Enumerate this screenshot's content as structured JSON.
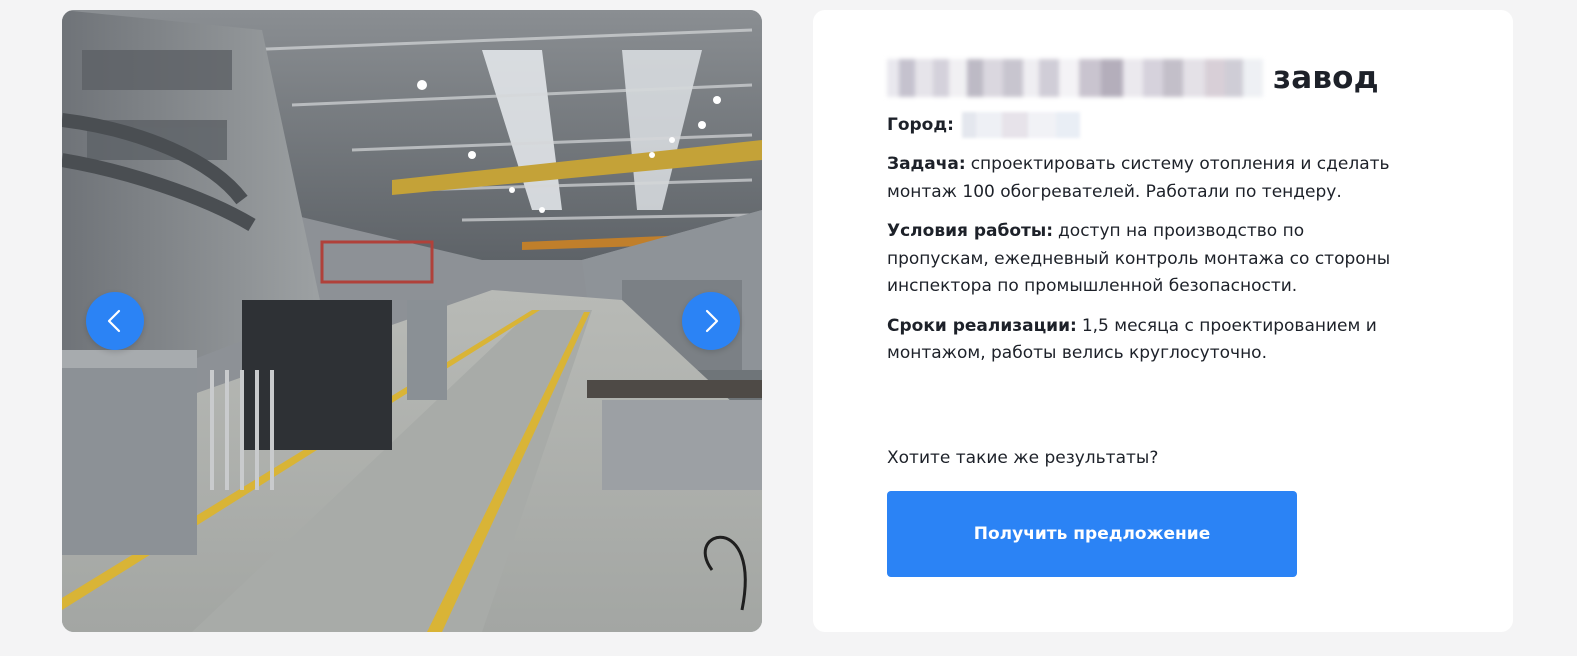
{
  "slider": {
    "prev_icon": "chevron-left-icon",
    "next_icon": "chevron-right-icon",
    "accent_color": "#2b83f5"
  },
  "card": {
    "title_suffix": "завод",
    "city_label": "Город:",
    "task_label": "Задача:",
    "task_text": "спроектировать систему отопления и сделать монтаж 100 обогревателей. Работали по тендеру.",
    "conditions_label": "Условия работы:",
    "conditions_text": "доступ на производство по пропускам, ежедневный контроль монтажа со стороны инспектора по промышленной безопасности.",
    "deadline_label": "Сроки реализации:",
    "deadline_text": "1,5 месяца с проектированием и монтажом, работы велись круглосуточно.",
    "cta_question": "Хотите такие же результаты?",
    "cta_button": "Получить предложение"
  }
}
